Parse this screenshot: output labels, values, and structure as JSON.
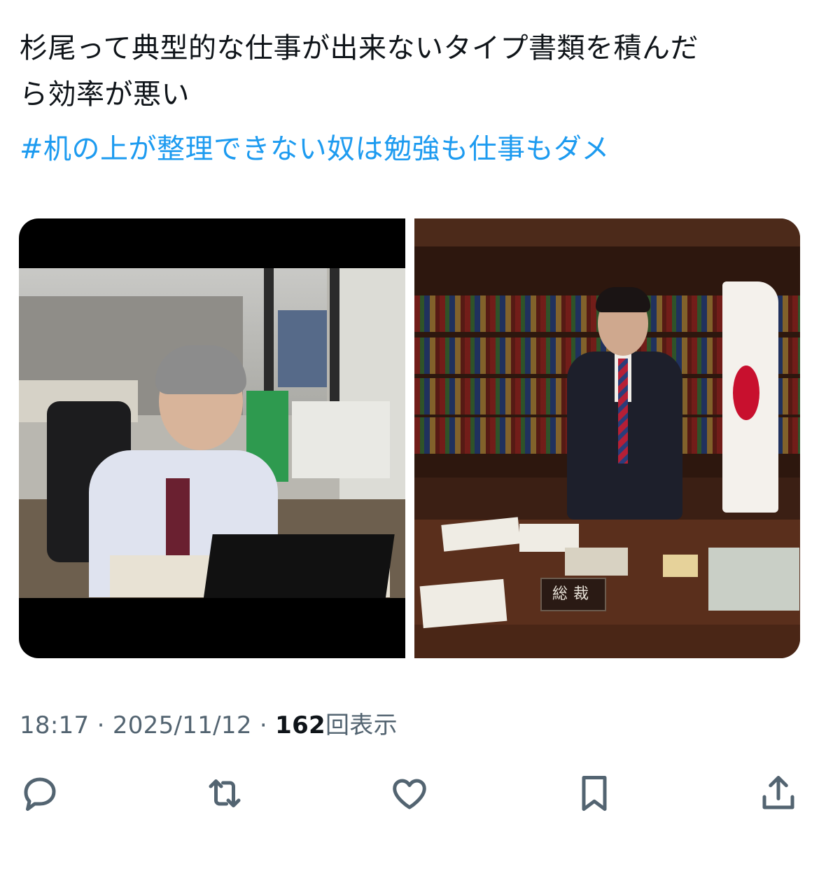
{
  "tweet": {
    "text_line_1": "杉尾って典型的な仕事が出来ないタイプ書類を積んだ",
    "text_line_2": "ら効率が悪い",
    "hashtag": "#机の上が整理できない奴は勉強も仕事もダメ"
  },
  "media": {
    "right_photo_nameplate": "総裁"
  },
  "meta": {
    "time": "18:17",
    "separator": "·",
    "date": "2025/11/12",
    "views_count": "162",
    "views_label": "回表示"
  },
  "actions": {
    "icons": [
      "reply-icon",
      "retweet-icon",
      "like-icon",
      "bookmark-icon",
      "share-icon"
    ]
  },
  "colors": {
    "link": "#1d9bf0",
    "secondary_text": "#536471",
    "primary_text": "#0f1419"
  }
}
